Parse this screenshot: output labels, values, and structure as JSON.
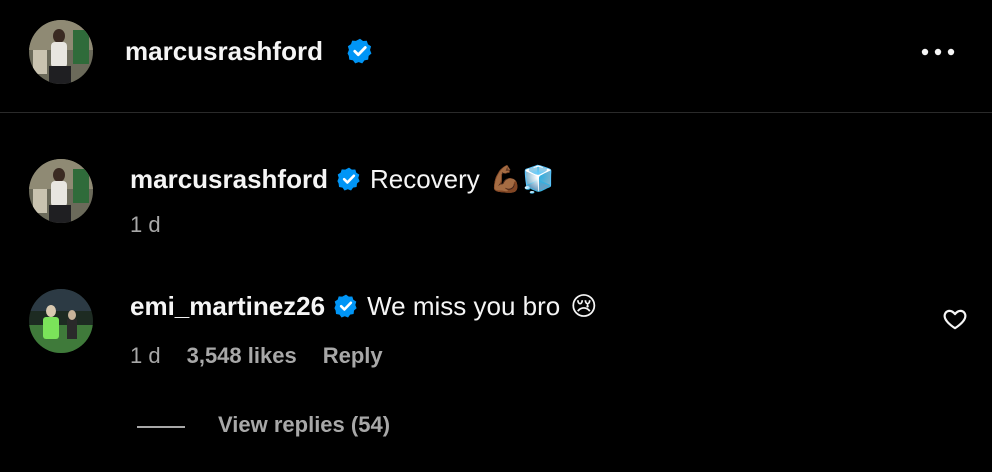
{
  "header": {
    "username": "marcusrashford",
    "more_icon": "more-horizontal-icon"
  },
  "caption": {
    "username": "marcusrashford",
    "text": "Recovery",
    "emojis": "💪🏾🧊",
    "time": "1 d"
  },
  "comment": {
    "username": "emi_martinez26",
    "text": "We miss you bro",
    "emoji": "😢",
    "time": "1 d",
    "likes": "3,548 likes",
    "reply_label": "Reply",
    "view_replies_label": "View replies (54)"
  },
  "colors": {
    "background": "#000000",
    "text": "#f5f5f5",
    "secondary": "#a8a8a8",
    "verified": "#0095f6"
  }
}
